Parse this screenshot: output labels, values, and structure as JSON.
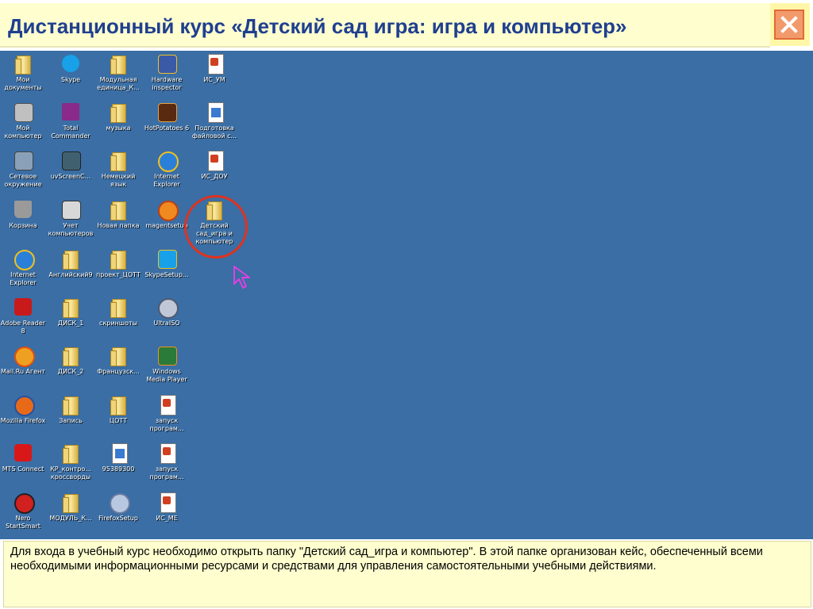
{
  "header": {
    "title": "Дистанционный курс «Детский сад игра: игра и компьютер»",
    "close_icon": "close-icon"
  },
  "desktop": {
    "background": "#3a6ea5",
    "icons": [
      {
        "name": "my-documents",
        "label": "Мои документы",
        "icon": "folder-docs-icon"
      },
      {
        "name": "skype",
        "label": "Skype",
        "icon": "skype-icon"
      },
      {
        "name": "modular-unit",
        "label": "Модульная единица_К...",
        "icon": "folder-icon"
      },
      {
        "name": "hardware-inspector",
        "label": "Hardware inspector",
        "icon": "hardware-icon"
      },
      {
        "name": "is-um",
        "label": "ИС_УМ",
        "icon": "document-icon"
      },
      {
        "name": "my-computer",
        "label": "Мой компьютер",
        "icon": "computer-icon"
      },
      {
        "name": "total-commander",
        "label": "Total Commander",
        "icon": "floppy-icon"
      },
      {
        "name": "music",
        "label": "музыка",
        "icon": "folder-icon"
      },
      {
        "name": "hotpotatoes",
        "label": "HotPotatoes 6",
        "icon": "hotpotatoes-icon"
      },
      {
        "name": "file-prep",
        "label": "Подготовка файловой с...",
        "icon": "document-icon"
      },
      {
        "name": "network",
        "label": "Сетевое окружение",
        "icon": "network-icon"
      },
      {
        "name": "uvscreen",
        "label": "uvScreenC...",
        "icon": "screen-capture-icon"
      },
      {
        "name": "german",
        "label": "Немецкий язык",
        "icon": "folder-icon"
      },
      {
        "name": "ie",
        "label": "Internet Explorer",
        "icon": "ie-icon"
      },
      {
        "name": "is-dou",
        "label": "ИС_ДОУ",
        "icon": "document-icon"
      },
      {
        "name": "recycle-bin",
        "label": "Корзина",
        "icon": "trash-icon"
      },
      {
        "name": "computer-accounting",
        "label": "Учет компьютеров",
        "icon": "network-computers-icon"
      },
      {
        "name": "new-folder",
        "label": "Новая папка",
        "icon": "folder-icon"
      },
      {
        "name": "magentsetup",
        "label": "magentsetup",
        "icon": "at-icon"
      },
      {
        "name": "kindergarten-folder",
        "label": "Детский сад_игра и компьютер",
        "icon": "folder-icon"
      },
      {
        "name": "ie2",
        "label": "Internet Explorer",
        "icon": "ie-icon"
      },
      {
        "name": "english",
        "label": "Английский9",
        "icon": "folder-icon"
      },
      {
        "name": "project-tsott",
        "label": "проект_ЦОТТ",
        "icon": "folder-icon"
      },
      {
        "name": "skypesetup",
        "label": "SkypeSetup...",
        "icon": "installer-icon"
      },
      {
        "name": "adobe-reader",
        "label": "Adobe Reader 8",
        "icon": "adobe-icon"
      },
      {
        "name": "disk1",
        "label": "ДИСК_1",
        "icon": "folder-icon"
      },
      {
        "name": "screenshots",
        "label": "скриншоты",
        "icon": "folder-icon"
      },
      {
        "name": "ultraiso",
        "label": "UltraISO",
        "icon": "disc-icon"
      },
      {
        "name": "mailru",
        "label": "Mail.Ru Агент",
        "icon": "mailru-icon"
      },
      {
        "name": "disk2",
        "label": "ДИСК_2",
        "icon": "folder-icon"
      },
      {
        "name": "french",
        "label": "Французск...",
        "icon": "folder-icon"
      },
      {
        "name": "wmp",
        "label": "Windows Media Player",
        "icon": "media-player-icon"
      },
      {
        "name": "firefox",
        "label": "Mozilla Firefox",
        "icon": "firefox-icon"
      },
      {
        "name": "record",
        "label": "Запись",
        "icon": "folder-icon"
      },
      {
        "name": "tsott",
        "label": "ЦОТТ",
        "icon": "folder-icon"
      },
      {
        "name": "launch-prog1",
        "label": "запуск програм...",
        "icon": "document-icon"
      },
      {
        "name": "mts-connect",
        "label": "MTS Connect",
        "icon": "mts-icon"
      },
      {
        "name": "kr-control",
        "label": "КР_контро... кроссворды",
        "icon": "folder-icon"
      },
      {
        "name": "file-95389300",
        "label": "95389300",
        "icon": "file-icon"
      },
      {
        "name": "launch-prog2",
        "label": "запуск програм...",
        "icon": "document-icon"
      },
      {
        "name": "nero",
        "label": "Nero StartSmart",
        "icon": "nero-icon"
      },
      {
        "name": "module-k",
        "label": "МОДУЛЬ_К...",
        "icon": "folder-icon"
      },
      {
        "name": "firefoxsetup",
        "label": "FirefoxSetup",
        "icon": "installer-icon"
      },
      {
        "name": "is-me",
        "label": "ИС_МЕ",
        "icon": "document-icon"
      }
    ]
  },
  "info": {
    "text": "Для входа в учебный курс необходимо открыть папку \"Детский сад_игра и компьютер\". В этой папке организован кейс, обеспеченный всеми необходимыми информационными ресурсами и средствами для управления самостоятельными учебными действиями."
  }
}
